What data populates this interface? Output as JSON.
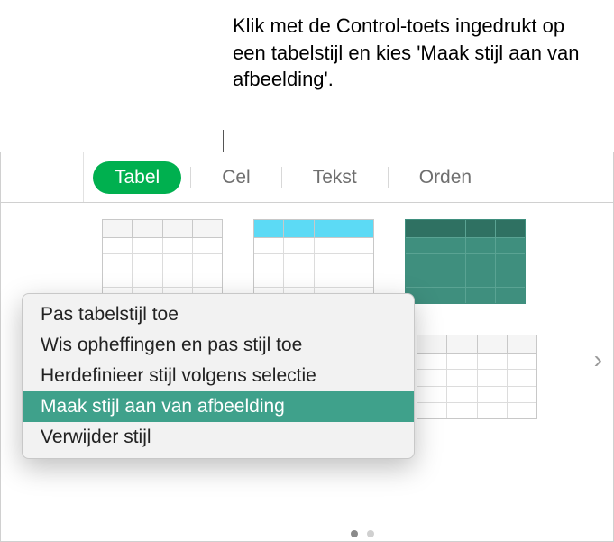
{
  "instruction": "Klik met de Control-toets ingedrukt op een tabelstijl en kies 'Maak stijl aan van afbeelding'.",
  "tabs": {
    "tabel": "Tabel",
    "cel": "Cel",
    "tekst": "Tekst",
    "orden": "Orden"
  },
  "styles": {
    "thumb1": "table-style-basic",
    "thumb2": "table-style-cyan-header",
    "thumb3": "table-style-teal-fill",
    "thumb4": "table-style-gray"
  },
  "contextMenu": {
    "items": [
      "Pas tabelstijl toe",
      "Wis opheffingen en pas stijl toe",
      "Herdefinieer stijl volgens selectie",
      "Maak stijl aan van afbeelding",
      "Verwijder stijl"
    ]
  },
  "navigation": {
    "next": "›"
  },
  "colors": {
    "accent": "#00b04f",
    "menuHighlight": "#3fa18b",
    "cyanHeader": "#5cdaf5",
    "tealFill": "#3f8f7e"
  }
}
